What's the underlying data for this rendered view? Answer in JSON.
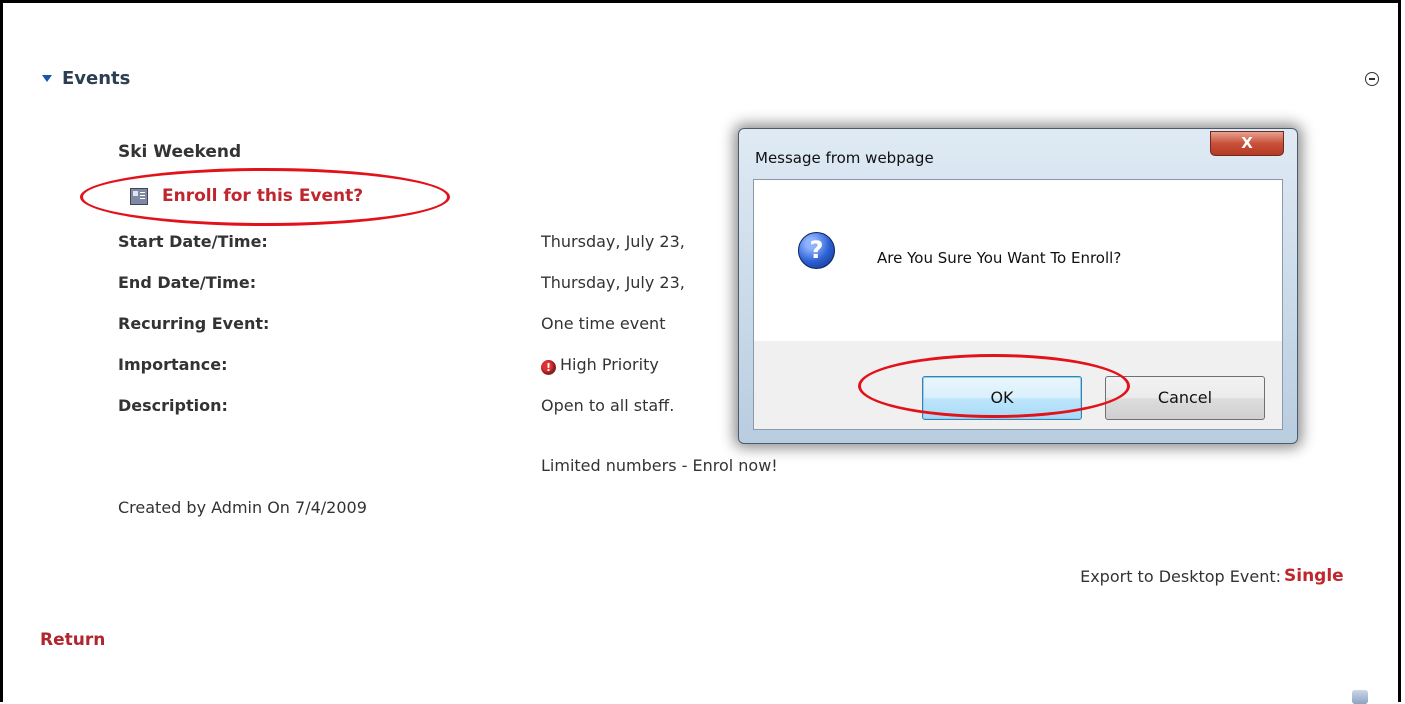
{
  "colors": {
    "accent_link": "#c0262d",
    "annotation_red": "#e3111a",
    "header_blue": "#1a56a8"
  },
  "section": {
    "title": "Events",
    "toggle_icon": "triangle-down-icon",
    "collapse_icon": "minus-circle-icon"
  },
  "event": {
    "name": "Ski Weekend",
    "enroll_link": "Enroll for this Event?",
    "enroll_icon": "calendar-icon",
    "fields": {
      "start": {
        "label": "Start Date/Time:",
        "value": "Thursday, July 23,"
      },
      "end": {
        "label": "End Date/Time:",
        "value": "Thursday, July 23,"
      },
      "recurring": {
        "label": "Recurring Event:",
        "value": "One time event"
      },
      "importance": {
        "label": "Importance:",
        "value": "High Priority",
        "icon": "exclamation-icon"
      },
      "description": {
        "label": "Description:",
        "value_line1": "Open to all staff.",
        "value_line2": "Limited numbers - Enrol now!"
      }
    },
    "created_by": "Created by Admin On 7/4/2009",
    "export_label": "Export to Desktop Event:",
    "export_link": "Single",
    "return_link": "Return"
  },
  "dialog": {
    "title": "Message from webpage",
    "close_label": "X",
    "icon": "question-icon",
    "message": "Are You Sure You Want To Enroll?",
    "ok_label": "OK",
    "cancel_label": "Cancel"
  }
}
